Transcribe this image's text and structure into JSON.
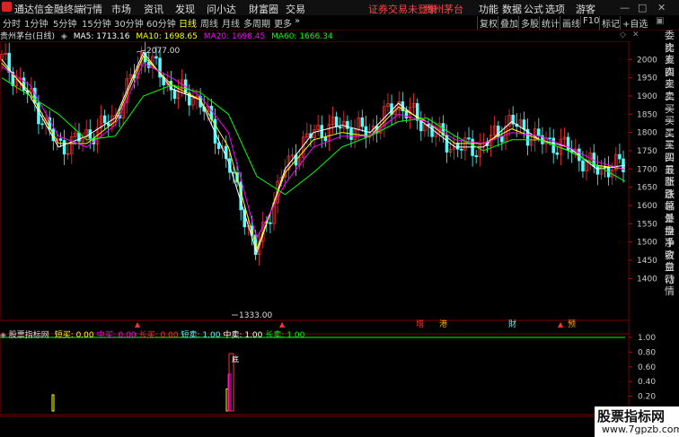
{
  "titlebar": {
    "app_name": "通达信金融终端",
    "menus": [
      "行情",
      "市场",
      "资讯",
      "发现",
      "问小达",
      "財富圈",
      "交易"
    ],
    "notice": "证券交易未登录",
    "stock": "贵州茅台",
    "right_menus": [
      "功能",
      "数据",
      "公式",
      "选项",
      "游客"
    ]
  },
  "toolbar": {
    "periods": [
      "分时",
      "1分钟",
      "5分钟",
      "15分钟",
      "30分钟",
      "60分钟",
      "日线",
      "周线",
      "月线",
      "多周期",
      "更多"
    ],
    "active": "日线",
    "right_buttons": [
      "复权",
      "叠加",
      "多股",
      "统计",
      "画线",
      "F10",
      "标记",
      "+自选"
    ]
  },
  "legend": {
    "stock_label": "贵州茅台(日线)",
    "ma5": "MA5: 1713.16",
    "ma10": "MA10: 1698.65",
    "ma20": "MA20: 1698.45",
    "ma60": "MA60: 1666.34"
  },
  "colors": {
    "up": "#ff3232",
    "down": "#54ffff",
    "ma5": "#ffffff",
    "ma10": "#ffff00",
    "ma20": "#ff00ff",
    "ma60": "#00ff00"
  },
  "price_axis": {
    "ticks": [
      "2000",
      "1950",
      "1900",
      "1850",
      "1800",
      "1750",
      "1700",
      "1650",
      "1600",
      "1550",
      "1500",
      "1450",
      "1400"
    ],
    "max": 2050,
    "min": 1300
  },
  "annotations": {
    "high": "2077.00",
    "low": "1333.00"
  },
  "event_markers": [
    "▲",
    "▲",
    "增",
    "港",
    "財",
    "▲",
    "预"
  ],
  "indicator": {
    "name": "股票指标网",
    "items": [
      {
        "label": "短买:",
        "value": "0.00",
        "color": "#ffff00"
      },
      {
        "label": "中买:",
        "value": "0.00",
        "color": "#ff00ff"
      },
      {
        "label": "长买:",
        "value": "0.00",
        "color": "#ff3232"
      },
      {
        "label": "短卖:",
        "value": "1.00",
        "color": "#54ffff"
      },
      {
        "label": "中卖:",
        "value": "1.00",
        "color": "#ffffff"
      },
      {
        "label": "长卖:",
        "value": "1.00",
        "color": "#00ff00"
      }
    ],
    "axis_ticks": [
      "1.00",
      "0.80",
      "0.60",
      "0.40",
      "0.20"
    ],
    "bottom_label": "底"
  },
  "date_axis": [
    "2022年",
    "3",
    "4",
    "5",
    "6",
    "7",
    "8",
    "9",
    "10",
    "11",
    "12",
    "2",
    "3",
    "4",
    "5",
    "6",
    "7",
    "8",
    "9",
    "10",
    "11",
    "12",
    "1"
  ],
  "right_panel": [
    "委比",
    "卖五",
    "卖四",
    "卖三",
    "卖二",
    "卖一",
    "买一",
    "买二",
    "买三",
    "买四",
    "买五",
    "最新",
    "涨跌",
    "涨幅",
    "总量",
    "外盘",
    "换手",
    "净资",
    "收益",
    "自动",
    "行情"
  ],
  "watermark": {
    "title": "股票指标网",
    "url": "www.7gpzb.com"
  },
  "chart_data": {
    "type": "line",
    "title": "贵州茅台(日线)",
    "ylim": [
      1300,
      2050
    ],
    "x": [
      "2022-01",
      "2022-03",
      "2022-04",
      "2022-05",
      "2022-06",
      "2022-07",
      "2022-08",
      "2022-09",
      "2022-10",
      "2022-11",
      "2022-12",
      "2023-02",
      "2023-03",
      "2023-04",
      "2023-05",
      "2023-06",
      "2023-07",
      "2023-08",
      "2023-09",
      "2023-10",
      "2023-11",
      "2023-12",
      "2024-01"
    ],
    "series": [
      {
        "name": "MA5",
        "values": [
          2000,
          1900,
          1760,
          1790,
          1840,
          2020,
          1920,
          1890,
          1720,
          1470,
          1700,
          1800,
          1820,
          1800,
          1880,
          1820,
          1760,
          1760,
          1830,
          1780,
          1760,
          1700,
          1710
        ]
      },
      {
        "name": "MA10",
        "values": [
          1990,
          1910,
          1770,
          1770,
          1830,
          2010,
          1930,
          1890,
          1760,
          1480,
          1690,
          1780,
          1800,
          1790,
          1870,
          1830,
          1770,
          1770,
          1810,
          1780,
          1750,
          1710,
          1700
        ]
      },
      {
        "name": "MA20",
        "values": [
          1980,
          1930,
          1790,
          1760,
          1820,
          1990,
          1950,
          1900,
          1800,
          1510,
          1660,
          1760,
          1790,
          1790,
          1850,
          1830,
          1780,
          1770,
          1800,
          1790,
          1760,
          1720,
          1698
        ]
      },
      {
        "name": "MA60",
        "values": [
          1950,
          1900,
          1850,
          1780,
          1790,
          1900,
          1930,
          1910,
          1850,
          1680,
          1630,
          1690,
          1760,
          1790,
          1830,
          1840,
          1790,
          1750,
          1780,
          1780,
          1750,
          1710,
          1666
        ]
      }
    ]
  }
}
